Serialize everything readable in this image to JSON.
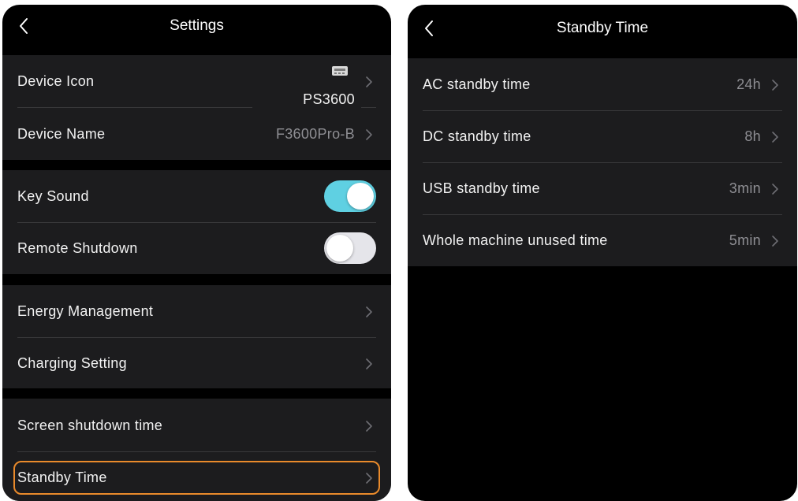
{
  "settings": {
    "title": "Settings",
    "device_icon": {
      "label": "Device Icon",
      "model": "PS3600"
    },
    "device_name": {
      "label": "Device Name",
      "value": "F3600Pro-B"
    },
    "key_sound": {
      "label": "Key Sound",
      "on": true
    },
    "remote_shutdown": {
      "label": "Remote Shutdown",
      "on": false
    },
    "energy_management": {
      "label": "Energy Management"
    },
    "charging_setting": {
      "label": "Charging Setting"
    },
    "screen_shutdown": {
      "label": "Screen shutdown time"
    },
    "standby_time": {
      "label": "Standby Time",
      "highlighted": true
    }
  },
  "standby": {
    "title": "Standby Time",
    "items": [
      {
        "label": "AC standby time",
        "value": "24h"
      },
      {
        "label": "DC standby time",
        "value": "8h"
      },
      {
        "label": "USB standby time",
        "value": "3min"
      },
      {
        "label": "Whole machine unused time",
        "value": "5min"
      }
    ]
  },
  "colors": {
    "toggle_on": "#5fd0e2",
    "highlight_border": "#e98a2b",
    "cell_background": "#1c1c1e",
    "screen_background": "#000000"
  }
}
